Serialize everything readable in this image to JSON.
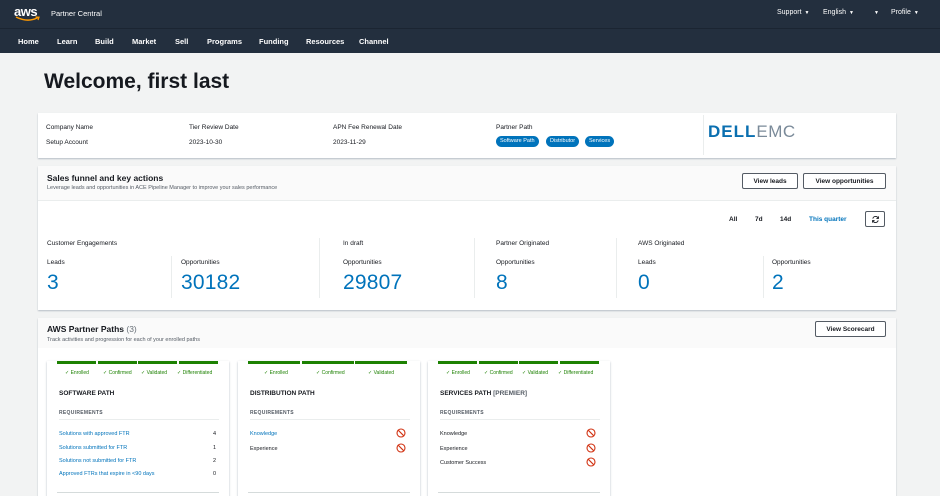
{
  "header": {
    "logo_text": "aws",
    "app_title": "Partner Central",
    "support_label": "Support",
    "language_label": "English",
    "profile_label": "Profile"
  },
  "nav": {
    "items": [
      "Home",
      "Learn",
      "Build",
      "Market",
      "Sell",
      "Programs",
      "Funding",
      "Resources",
      "Channel"
    ]
  },
  "welcome": "Welcome, first last",
  "company": {
    "name_label": "Company Name",
    "name_value": "Setup Account",
    "tier_label": "Tier Review Date",
    "tier_value": "2023-10-30",
    "apn_label": "APN Fee Renewal Date",
    "apn_value": "2023-11-29",
    "path_label": "Partner Path",
    "paths": [
      "Software Path",
      "Distributor",
      "Services"
    ],
    "logo_primary": "DELL",
    "logo_secondary": "EMC"
  },
  "funnel": {
    "title": "Sales funnel and key actions",
    "subtitle": "Leverage leads and opportunities in ACE Pipeline Manager to improve your sales performance",
    "view_leads": "View leads",
    "view_opps": "View opportunities",
    "ranges": [
      "All",
      "7d",
      "14d",
      "This quarter"
    ],
    "active_range": "This quarter",
    "groups": {
      "customer": "Customer Engagements",
      "draft": "In draft",
      "partner": "Partner Originated",
      "aws": "AWS Originated"
    },
    "metrics": [
      {
        "label": "Leads",
        "value": "3"
      },
      {
        "label": "Opportunities",
        "value": "30182"
      },
      {
        "label": "Opportunities",
        "value": "29807"
      },
      {
        "label": "Opportunities",
        "value": "8"
      },
      {
        "label": "Leads",
        "value": "0"
      },
      {
        "label": "Opportunities",
        "value": "2"
      }
    ]
  },
  "paths_section": {
    "title": "AWS Partner Paths",
    "count": "(3)",
    "subtitle": "Track activities and progression for each of your enrolled paths",
    "scorecard": "View Scorecard",
    "step_labels": [
      "Enrolled",
      "Confirmed",
      "Validated",
      "Differentiated"
    ],
    "requirements_label": "REQUIREMENTS",
    "software": {
      "title": "SOFTWARE PATH",
      "reqs": [
        {
          "label": "Solutions with approved FTR",
          "count": "4"
        },
        {
          "label": "Solutions submitted for FTR",
          "count": "1"
        },
        {
          "label": "Solutions not submitted for FTR",
          "count": "2"
        },
        {
          "label": "Approved FTRs that expire in <90 days",
          "count": "0"
        }
      ]
    },
    "distribution": {
      "title": "DISTRIBUTION PATH",
      "reqs": [
        "Knowledge",
        "Experience"
      ]
    },
    "services": {
      "title": "SERVICES PATH",
      "tag": "[PREMIER]",
      "reqs": [
        "Knowledge",
        "Experience",
        "Customer Success"
      ]
    }
  },
  "colors": {
    "header_bg": "#232f3e",
    "link": "#0073bb",
    "success": "#1d8102",
    "danger": "#d13212"
  }
}
